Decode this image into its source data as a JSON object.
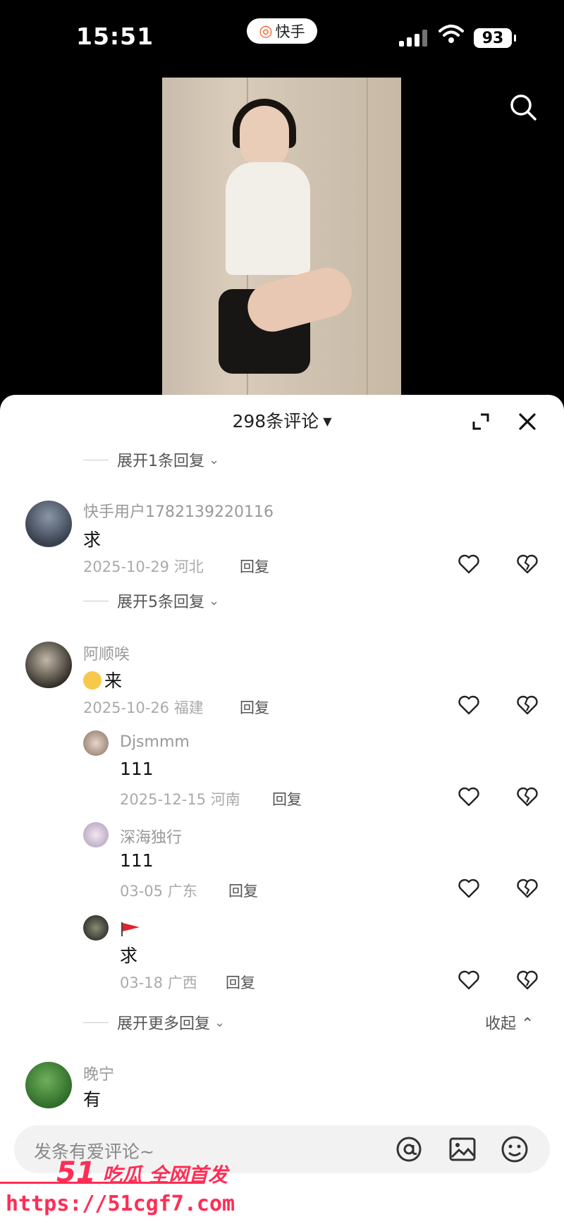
{
  "status_bar": {
    "time": "15:51",
    "app_name": "快手",
    "battery": "93"
  },
  "sheet": {
    "title": "298条评论"
  },
  "toggles": {
    "expand_1": "展开1条回复",
    "expand_5": "展开5条回复",
    "expand_more": "展开更多回复",
    "collapse": "收起"
  },
  "comments": [
    {
      "name": "快手用户1782139220116",
      "text": "求",
      "date": "2025-10-29",
      "region": "河北",
      "reply": "回复"
    },
    {
      "name": "阿顺唉",
      "text": "来",
      "date": "2025-10-26",
      "region": "福建",
      "reply": "回复"
    },
    {
      "name": "Djsmmm",
      "text": "111",
      "date": "2025-12-15",
      "region": "河南",
      "reply": "回复"
    },
    {
      "name": "深海独行",
      "text": "111",
      "date": "03-05",
      "region": "广东",
      "reply": "回复"
    },
    {
      "name": "",
      "text": "求",
      "date": "03-18",
      "region": "广西",
      "reply": "回复"
    },
    {
      "name": "晚宁",
      "text": "有"
    }
  ],
  "input": {
    "placeholder": "发条有爱评论~"
  },
  "watermark": {
    "brand_num": "51",
    "brand_text": "吃瓜 全网首发",
    "url": "https://51cgf7.com"
  },
  "colors": {
    "accent": "#ff2d55",
    "kuaishou_orange": "#ff5a1f"
  }
}
